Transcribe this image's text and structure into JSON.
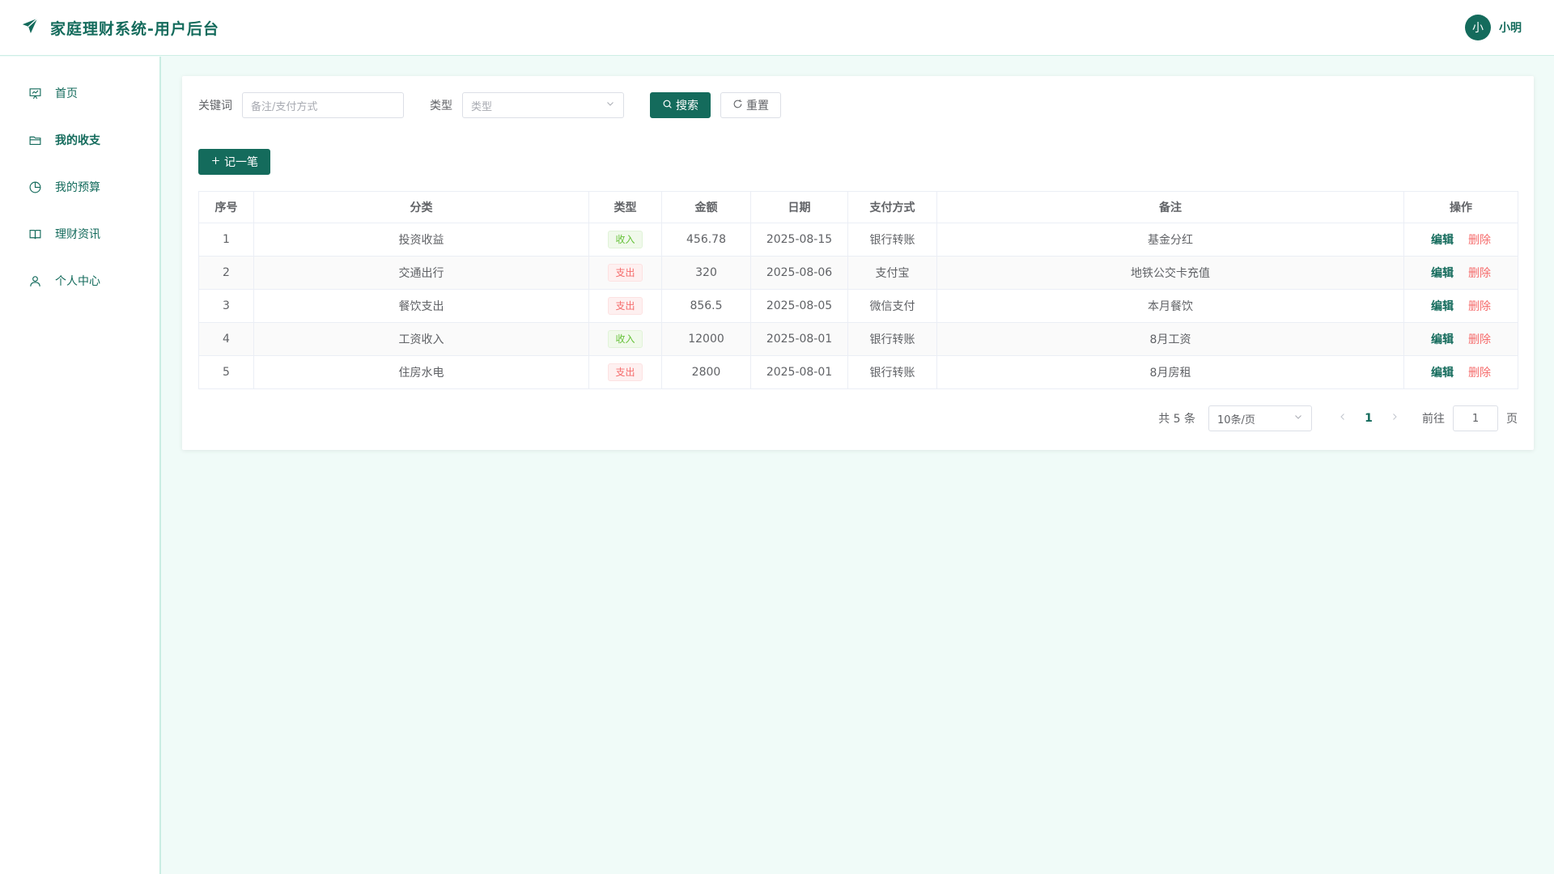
{
  "header": {
    "title": "家庭理财系统-用户后台",
    "logo_icon": "paper-plane-icon",
    "user": {
      "avatar_text": "小",
      "name": "小明"
    }
  },
  "sidebar": {
    "items": [
      {
        "label": "首页",
        "icon": "presentation-icon",
        "active": false
      },
      {
        "label": "我的收支",
        "icon": "folder-icon",
        "active": true
      },
      {
        "label": "我的预算",
        "icon": "pie-chart-icon",
        "active": false
      },
      {
        "label": "理财资讯",
        "icon": "book-icon",
        "active": false
      },
      {
        "label": "个人中心",
        "icon": "user-icon",
        "active": false
      }
    ]
  },
  "filters": {
    "keyword_label": "关键词",
    "keyword_placeholder": "备注/支付方式",
    "type_label": "类型",
    "type_placeholder": "类型",
    "search_label": "搜索",
    "reset_label": "重置"
  },
  "actions": {
    "add_label": "记一笔"
  },
  "table": {
    "columns": [
      "序号",
      "分类",
      "类型",
      "金额",
      "日期",
      "支付方式",
      "备注",
      "操作"
    ],
    "rows": [
      {
        "index": "1",
        "category": "投资收益",
        "type": "收入",
        "amount": "456.78",
        "date": "2025-08-15",
        "payment": "银行转账",
        "note": "基金分红"
      },
      {
        "index": "2",
        "category": "交通出行",
        "type": "支出",
        "amount": "320",
        "date": "2025-08-06",
        "payment": "支付宝",
        "note": "地铁公交卡充值"
      },
      {
        "index": "3",
        "category": "餐饮支出",
        "type": "支出",
        "amount": "856.5",
        "date": "2025-08-05",
        "payment": "微信支付",
        "note": "本月餐饮"
      },
      {
        "index": "4",
        "category": "工资收入",
        "type": "收入",
        "amount": "12000",
        "date": "2025-08-01",
        "payment": "银行转账",
        "note": "8月工资"
      },
      {
        "index": "5",
        "category": "住房水电",
        "type": "支出",
        "amount": "2800",
        "date": "2025-08-01",
        "payment": "银行转账",
        "note": "8月房租"
      }
    ],
    "edit_label": "编辑",
    "delete_label": "删除"
  },
  "pagination": {
    "total_text": "共 5 条",
    "page_size": "10条/页",
    "current_page": "1",
    "goto_label": "前往",
    "goto_value": "1",
    "unit_label": "页"
  },
  "colors": {
    "primary": "#146b5c",
    "income": "#67c23a",
    "expense": "#f56c6c"
  }
}
